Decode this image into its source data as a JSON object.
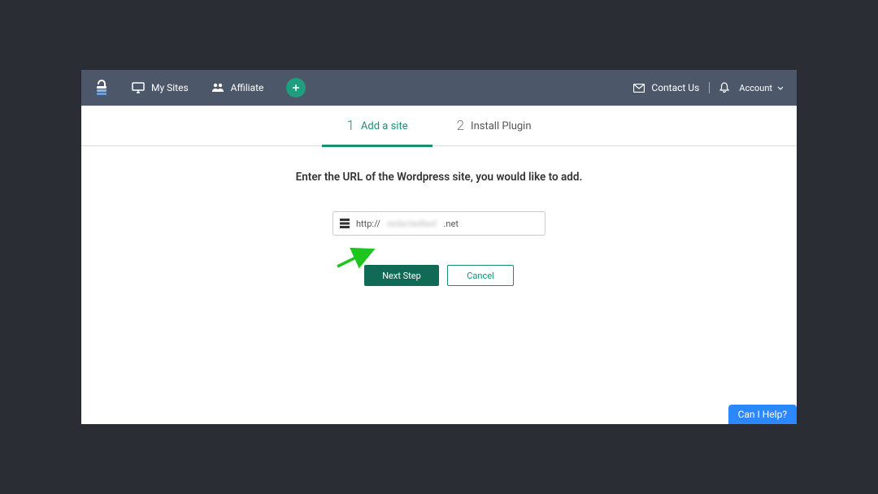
{
  "nav": {
    "mySites": "My Sites",
    "affiliate": "Affiliate",
    "contactUs": "Contact Us",
    "account": "Account"
  },
  "tabs": [
    {
      "num": "1",
      "label": "Add a site",
      "active": true
    },
    {
      "num": "2",
      "label": "Install Plugin",
      "active": false
    }
  ],
  "content": {
    "instruction": "Enter the URL of the Wordpress site, you would like to add.",
    "urlPrefix": "http://",
    "urlRedacted": "redactedtext",
    "urlSuffix": ".net"
  },
  "buttons": {
    "next": "Next Step",
    "cancel": "Cancel"
  },
  "help": {
    "label": "Can I Help?"
  }
}
